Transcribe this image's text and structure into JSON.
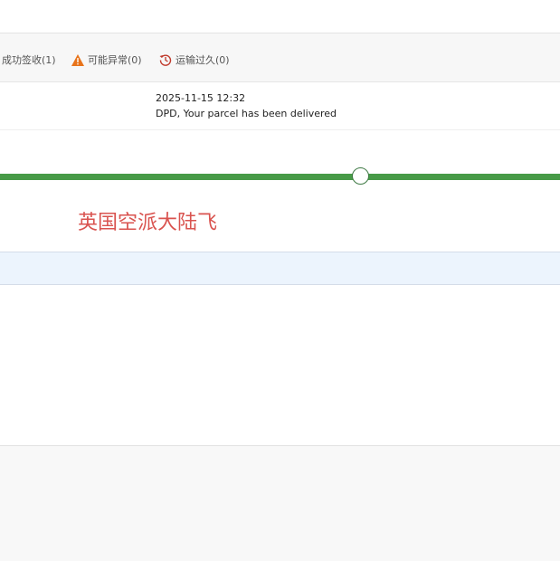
{
  "filters": [
    {
      "label": "成功签收(1)",
      "icon": "none"
    },
    {
      "label": "可能异常(0)",
      "icon": "warning-icon",
      "color": "#e8731a"
    },
    {
      "label": "运输过久(0)",
      "icon": "history-icon",
      "color": "#c0392b"
    }
  ],
  "event": {
    "time": "2025-11-15 12:32",
    "description": "DPD, Your parcel has been delivered"
  },
  "route": {
    "label": "英国空派大陆飞",
    "color": "#d9534f",
    "track_color": "#479a47"
  }
}
